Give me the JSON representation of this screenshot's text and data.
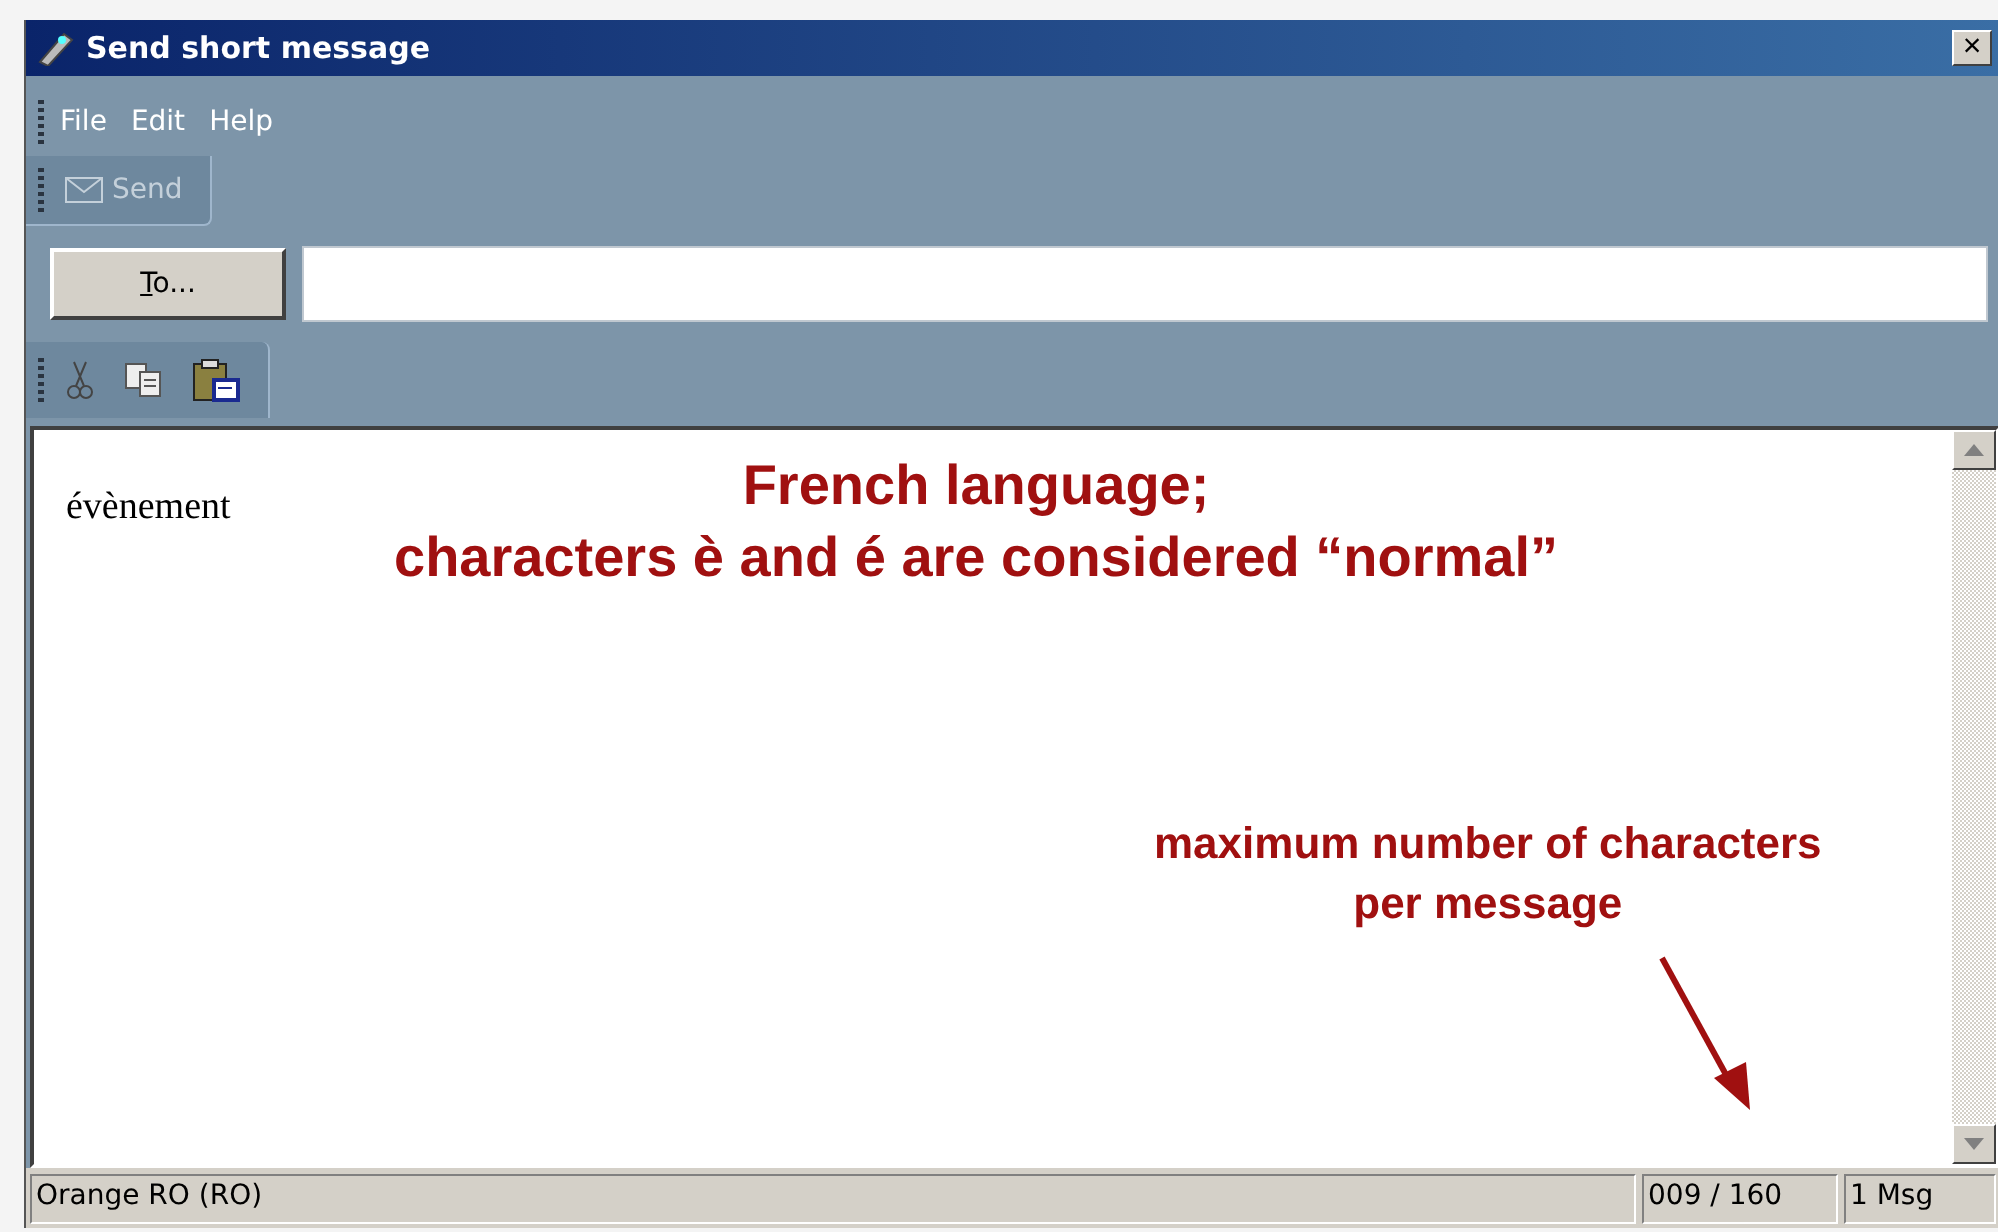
{
  "window": {
    "title": "Send short message",
    "close": "×"
  },
  "menu": [
    "File",
    "Edit",
    "Help"
  ],
  "toolbar": {
    "send": {
      "label": "Send",
      "disabled": true
    }
  },
  "to": {
    "button": "To..."
  },
  "edit_toolbar": [
    {
      "kind": "cut"
    },
    {
      "kind": "copy"
    },
    {
      "kind": "paste"
    }
  ],
  "message": {
    "text": "évènement"
  },
  "annotations": [
    {
      "lines": [
        "French language;",
        "characters è and é are considered “normal”"
      ]
    },
    {
      "lines": [
        "maximum number of characters",
        "per message"
      ]
    }
  ],
  "status_bar": {
    "operator": "Orange RO (RO)",
    "count": "009 / 160",
    "messages": "1 Msg"
  }
}
